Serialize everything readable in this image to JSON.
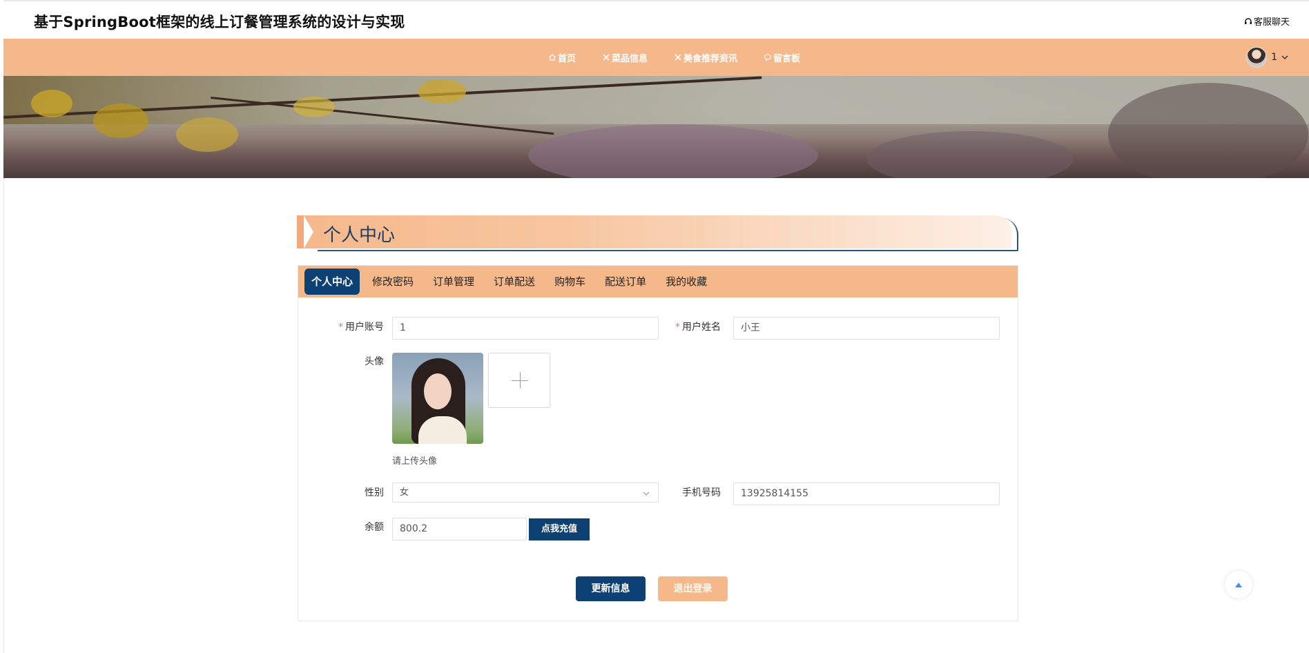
{
  "header": {
    "site_title": "基于SpringBoot框架的线上订餐管理系统的设计与实现",
    "chat_label": "客服聊天"
  },
  "nav": {
    "items": [
      {
        "label": "首页",
        "icon": "home-icon"
      },
      {
        "label": "菜品信息",
        "icon": "utensils-icon"
      },
      {
        "label": "美食推荐资讯",
        "icon": "utensils-icon"
      },
      {
        "label": "留言板",
        "icon": "message-icon"
      }
    ],
    "user_name": "1"
  },
  "section": {
    "title": "个人中心"
  },
  "tabs": [
    "个人中心",
    "修改密码",
    "订单管理",
    "订单配送",
    "购物车",
    "配送订单",
    "我的收藏"
  ],
  "active_tab": "个人中心",
  "form": {
    "account_label": "用户账号",
    "account_value": "1",
    "name_label": "用户姓名",
    "name_value": "小王",
    "avatar_label": "头像",
    "avatar_hint": "请上传头像",
    "gender_label": "性别",
    "gender_value": "女",
    "phone_label": "手机号码",
    "phone_value": "13925814155",
    "balance_label": "余额",
    "balance_value": "800.2",
    "recharge_label": "点我充值"
  },
  "actions": {
    "update_label": "更新信息",
    "logout_label": "退出登录"
  },
  "colors": {
    "accent": "#f5b88b",
    "primary": "#0d4174"
  }
}
